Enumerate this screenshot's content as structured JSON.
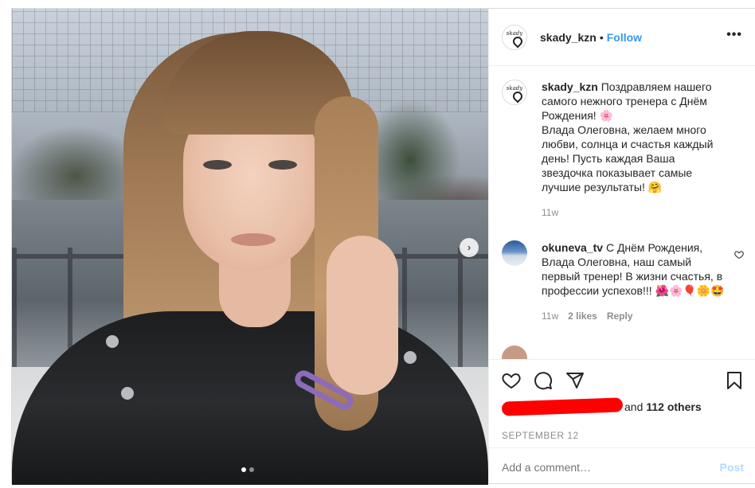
{
  "post": {
    "author": "skady_kzn",
    "follow_separator": "•",
    "follow_label": "Follow",
    "more_label": "•••",
    "avatar_text": "skady"
  },
  "photo": {
    "next_icon": "chevron-right-icon",
    "next_label": "›",
    "slides": 2,
    "current_slide": 1
  },
  "caption": {
    "user": "skady_kzn",
    "text": "Поздравляем нашего самого нежного тренера с Днём Рождения! 🌸\nВлада Олеговна, желаем много любви, солнца и счастья каждый день! Пусть каждая Ваша звездочка показывает самые лучшие результаты! 🤗",
    "time": "11w"
  },
  "comments": [
    {
      "user": "okuneva_tv",
      "text": "С Днём Рождения, Влада Олеговна, наш самый первый тренер! В жизни счастья, в профессии успехов!!! 🌺🌸🎈🌼🤩",
      "time": "11w",
      "likes": "2 likes",
      "reply": "Reply"
    }
  ],
  "partial_comment": {
    "text": "..."
  },
  "actions": {
    "like_icon": "heart-icon",
    "comment_icon": "comment-icon",
    "share_icon": "share-icon",
    "save_icon": "bookmark-icon",
    "likes_suffix": "and",
    "likes_others": "112 others",
    "date": "SEPTEMBER 12"
  },
  "add_comment": {
    "placeholder": "Add a comment…",
    "post_label": "Post"
  },
  "colors": {
    "accent": "#3897f0",
    "post_disabled": "#b3dbff",
    "redaction": "#ff0000"
  }
}
